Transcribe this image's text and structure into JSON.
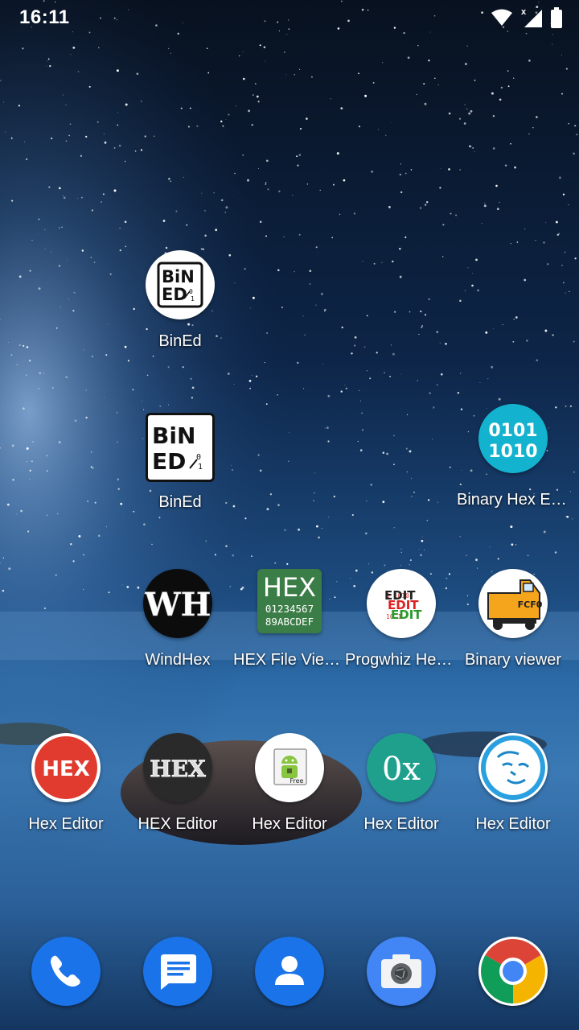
{
  "status_bar": {
    "time": "16:11"
  },
  "apps": [
    {
      "label": "BinEd",
      "icon": "bined-round-icon"
    },
    {
      "label": "BinEd",
      "icon": "bined-square-icon"
    },
    {
      "label": "Binary Hex Edi…",
      "icon": "binary-hex-editor-icon",
      "icon_text_1": "0101",
      "icon_text_2": "1010"
    },
    {
      "label": "WindHex",
      "icon": "windhex-icon",
      "icon_text": "WH"
    },
    {
      "label": "HEX File Viewer",
      "icon": "hex-file-viewer-icon",
      "icon_text_1": "HEX",
      "icon_text_2": "01234567",
      "icon_text_3": "89ABCDEF"
    },
    {
      "label": "Progwhiz Hex…",
      "icon": "progwhiz-hex-icon",
      "icon_text": "EDIT"
    },
    {
      "label": "Binary viewer",
      "icon": "binary-viewer-icon",
      "icon_text": "FCF0"
    },
    {
      "label": "Hex Editor",
      "icon": "hex-editor-red-icon",
      "icon_text": "HEX"
    },
    {
      "label": "HEX Editor",
      "icon": "hex-editor-dark-icon",
      "icon_text": "HEX"
    },
    {
      "label": "Hex Editor",
      "icon": "hex-editor-android-icon",
      "icon_text": "Free"
    },
    {
      "label": "Hex Editor",
      "icon": "hex-editor-0x-icon",
      "icon_text": "0x"
    },
    {
      "label": "Hex Editor",
      "icon": "hex-editor-face-icon"
    }
  ],
  "bined_icon_text": {
    "line1": "BiN",
    "line2": "ED",
    "bits1": "0",
    "bits2": "1"
  },
  "dock": [
    {
      "icon": "phone-icon",
      "color": "#1a73e8"
    },
    {
      "icon": "messages-icon",
      "color": "#1a73e8"
    },
    {
      "icon": "contacts-icon",
      "color": "#1a73e8"
    },
    {
      "icon": "camera-icon",
      "color": "#4285f4"
    },
    {
      "icon": "chrome-icon",
      "color": "#ffffff"
    }
  ]
}
